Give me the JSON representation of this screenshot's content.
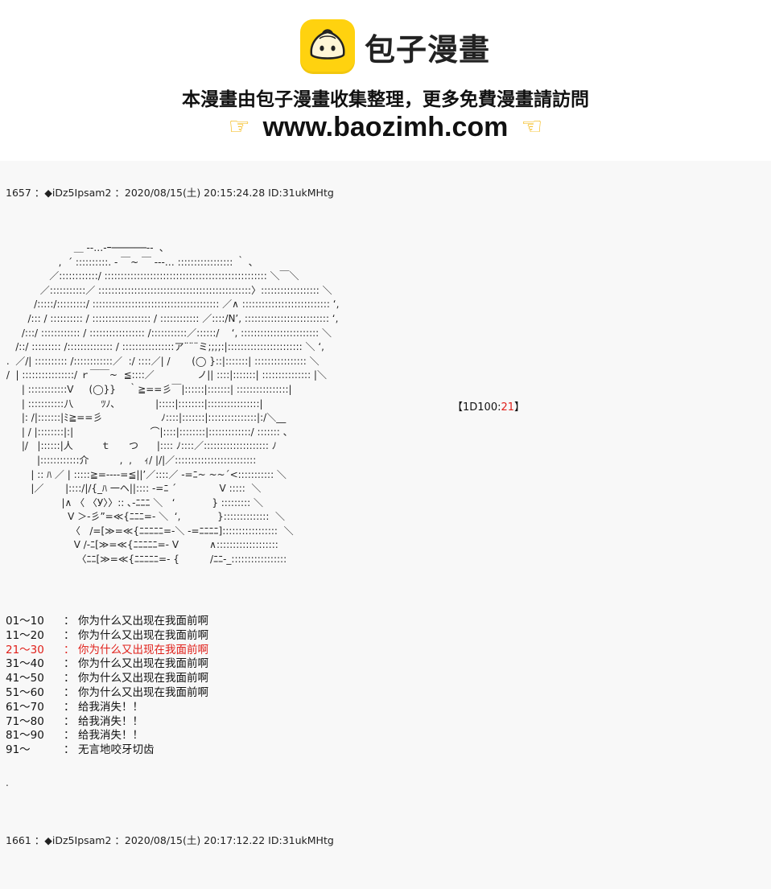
{
  "banner": {
    "logo_text": "包子漫畫",
    "tagline": "本漫畫由包子漫畫收集整理，更多免費漫畫請訪問",
    "url": "www.baozimh.com",
    "left_icon": "pointing-right-hand-icon",
    "right_icon": "pointing-left-hand-icon",
    "accent_color": "#ffd20f"
  },
  "posts": [
    {
      "header": "1657 ：◆iDz5Ipsam2 ：2020/08/15(土) 20:15:24.28 ID:31ukMHtg"
    },
    {
      "header": "1661 ：◆iDz5Ipsam2 ：2020/08/15(土) 20:17:12.22 ID:31ukMHtg"
    }
  ],
  "dice": {
    "prefix": "【1D100:",
    "value": "21",
    "suffix": "】"
  },
  "results": [
    {
      "range": "01～10",
      "colon": "：",
      "text": "你为什么又出现在我面前啊"
    },
    {
      "range": "11～20",
      "colon": "：",
      "text": "你为什么又出现在我面前啊"
    },
    {
      "range": "21～30",
      "colon": "：",
      "text": "你为什么又出现在我面前啊"
    },
    {
      "range": "31～40",
      "colon": "：",
      "text": "你为什么又出现在我面前啊"
    },
    {
      "range": "41～50",
      "colon": "：",
      "text": "你为什么又出现在我面前啊"
    },
    {
      "range": "51～60",
      "colon": "：",
      "text": "你为什么又出现在我面前啊"
    },
    {
      "range": "61～70",
      "colon": "：",
      "text": "给我消失！！"
    },
    {
      "range": "71～80",
      "colon": "：",
      "text": "给我消失！！"
    },
    {
      "range": "81～90",
      "colon": "：",
      "text": "给我消失！！"
    },
    {
      "range": "91～",
      "colon": "：",
      "text": "无言地咬牙切齿"
    }
  ],
  "highlight_color": "#e0201a",
  "trailing_dot": "."
}
